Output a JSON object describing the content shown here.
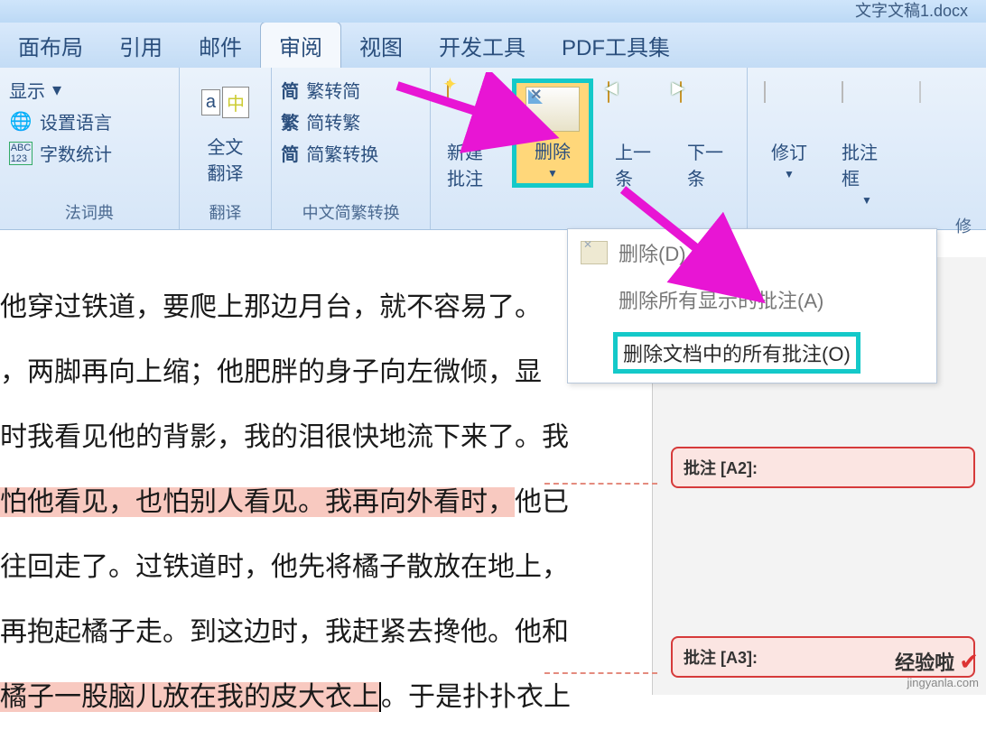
{
  "title": "文字文稿1.docx",
  "tabs": [
    "面布局",
    "引用",
    "邮件",
    "审阅",
    "视图",
    "开发工具",
    "PDF工具集"
  ],
  "active_tab": "审阅",
  "ribbon": {
    "proof": {
      "show": "显示",
      "lang": "设置语言",
      "count": "字数统计",
      "group_label": "法词典"
    },
    "translate": {
      "btn": "全文\n翻译",
      "group_label": "翻译"
    },
    "convert": {
      "items": [
        "繁转简",
        "简转繁",
        "简繁转换"
      ],
      "prefix": [
        "简",
        "繁",
        "简"
      ],
      "group_label": "中文简繁转换"
    },
    "comments": {
      "new": "新建批注",
      "del": "删除",
      "prev": "上一\n条",
      "next": "下一\n条"
    },
    "track": {
      "track": "修订",
      "balloon": "批注框",
      "group_label": "修"
    }
  },
  "dropdown": {
    "d1": "删除(D)",
    "d2": "删除所有显示的批注(A)",
    "d3": "删除文档中的所有批注(O)"
  },
  "doc": {
    "l1": "他穿过铁道，要爬上那边月台，就不容易了。",
    "l2a": "，两脚再向上缩；他肥胖的身子向左微倾，",
    "l2b": "显",
    "l3": "时我看见他的背影，我的泪很快地流下来了。我",
    "l4a": "怕他看见，也怕别人看见。我再向外看时，",
    "l4b": "他已",
    "l5": "往回走了。过铁道时，他先将橘子散放在地上，",
    "l6": "再抱起橘子走。到这边时，我赶紧去搀他。他和",
    "l7a": "橘子一股脑儿放在我的皮大衣上",
    "l7b": "。于是扑扑衣上"
  },
  "comments": {
    "c1": "批注 [A2]:",
    "c2": "批注 [A3]:"
  },
  "watermark": {
    "brand": "经验啦",
    "url": "jingyanla.com"
  }
}
